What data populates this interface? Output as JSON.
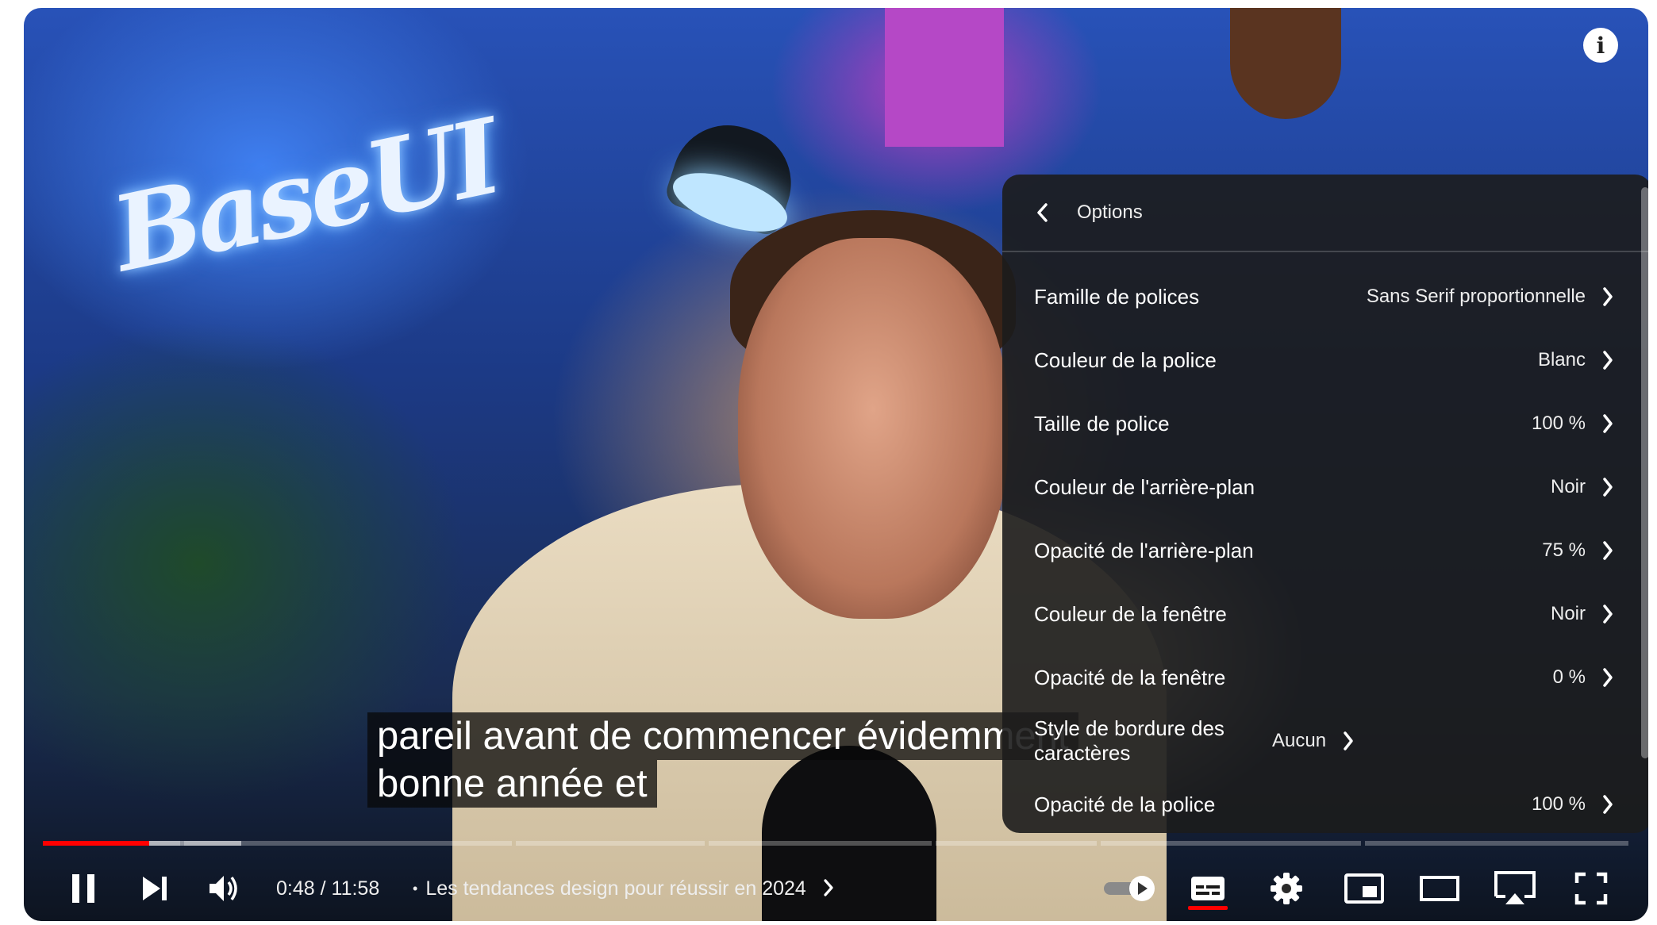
{
  "captions": {
    "line1": "pareil avant de commencer évidemment",
    "line2": "bonne année et"
  },
  "menu": {
    "title": "Options",
    "items": [
      {
        "label": "Famille de polices",
        "value": "Sans Serif proportionnelle"
      },
      {
        "label": "Couleur de la police",
        "value": "Blanc"
      },
      {
        "label": "Taille de police",
        "value": "100 %"
      },
      {
        "label": "Couleur de l'arrière-plan",
        "value": "Noir"
      },
      {
        "label": "Opacité de l'arrière-plan",
        "value": "75 %"
      },
      {
        "label": "Couleur de la fenêtre",
        "value": "Noir"
      },
      {
        "label": "Opacité de la fenêtre",
        "value": "0 %"
      },
      {
        "label": "Style de bordure des caractères",
        "value": "Aucun"
      },
      {
        "label": "Opacité de la police",
        "value": "100 %"
      }
    ]
  },
  "player": {
    "time_current": "0:48",
    "time_separator": " / ",
    "time_total": "11:58",
    "chapter_bullet": "•",
    "chapter_title": "Les tendances design pour réussir en 2024",
    "played_fraction": 0.067,
    "buffered_fraction": 0.125,
    "progress_color": "#ff0000",
    "autoplay_on": true,
    "subtitles_on": true
  },
  "icons": {
    "info": "info-icon",
    "pause": "pause-icon",
    "next": "next-icon",
    "volume": "volume-icon",
    "autoplay": "autoplay-toggle-icon",
    "subtitles": "subtitles-icon",
    "settings": "gear-icon",
    "miniplayer": "miniplayer-icon",
    "theater": "theater-mode-icon",
    "cast": "cast-icon",
    "fullscreen": "fullscreen-icon"
  }
}
